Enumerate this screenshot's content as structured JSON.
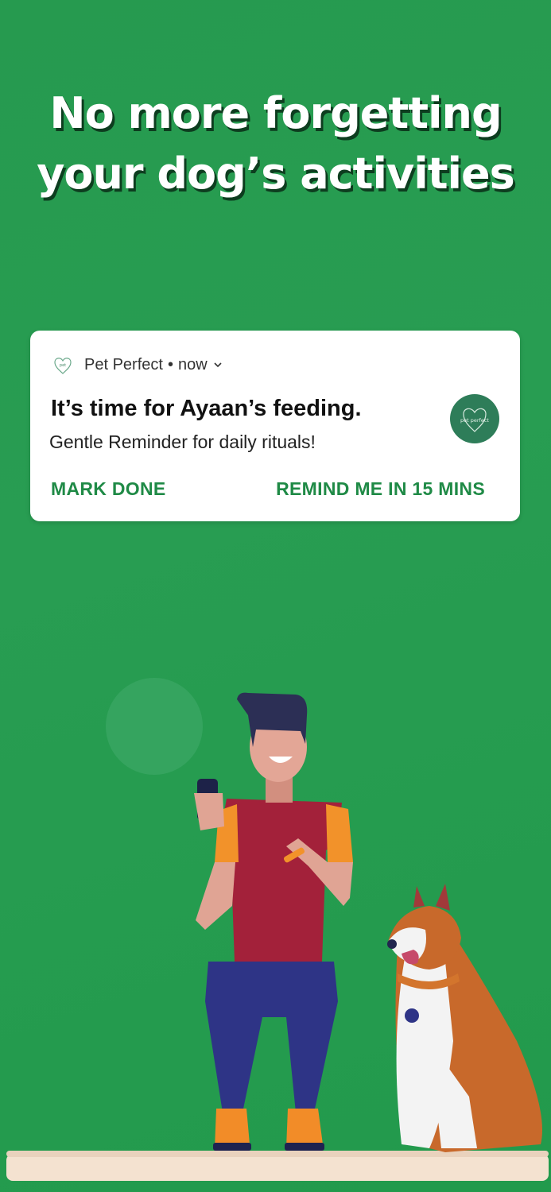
{
  "headline": {
    "line1": "No more forgetting",
    "line2": "your dog’s activities"
  },
  "notification": {
    "app_name": "Pet Perfect",
    "separator": "•",
    "time": "now",
    "title": "It’s time for Ayaan’s feeding.",
    "body": "Gentle Reminder for daily rituals!",
    "avatar_text": "pet perfect",
    "actions": {
      "mark_done": "MARK DONE",
      "remind": "REMIND ME IN 15 MINS"
    }
  },
  "colors": {
    "background": "#269a4f",
    "accent": "#1f8a46",
    "avatar": "#2e7d59"
  }
}
